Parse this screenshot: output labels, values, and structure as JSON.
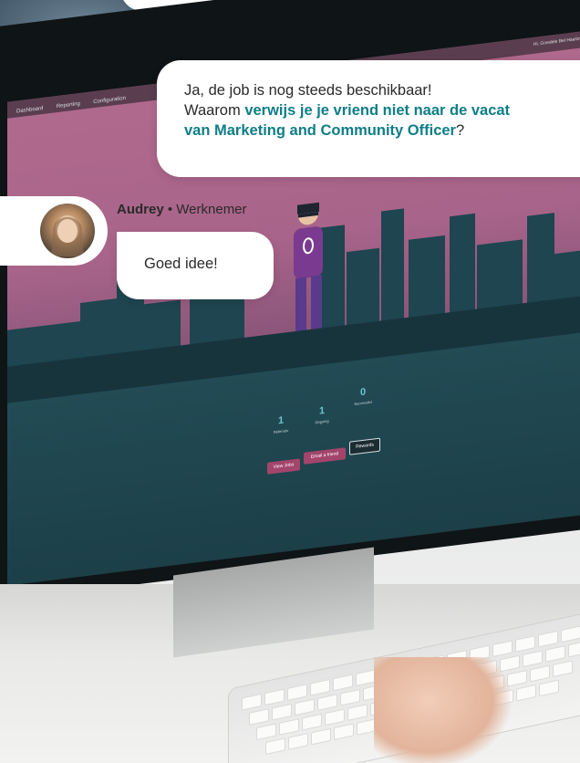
{
  "chat": {
    "message_line1": "Ja, de job is nog steeds beschikbaar!",
    "message_line2_prefix": "Waarom ",
    "message_line2_link": "verwijs je je vriend niet naar de vacat",
    "message_line3_link": "van Marketing and Community Officer",
    "message_line3_suffix": "?",
    "sender_name": "Audrey",
    "sender_separator": " • ",
    "sender_role": "Werknemer",
    "reply": "Goed idee!"
  },
  "screen": {
    "menu": [
      "Dashboard",
      "Reporting",
      "Configuration"
    ],
    "tray_text": "Hi, Goedele Bel Haelimi",
    "stats": [
      {
        "value": "1",
        "label": "Referrals"
      },
      {
        "value": "1",
        "label": "Ongoing"
      },
      {
        "value": "0",
        "label": "Successful"
      }
    ],
    "buttons": {
      "view_jobs": "View Jobs",
      "email_friend": "Email a friend",
      "rewards": "Rewards"
    }
  },
  "colors": {
    "accent": "#0f7e87",
    "screen_pink": "#b06a8d",
    "screen_teal": "#1c3f48",
    "button_pink": "#a3456b"
  }
}
